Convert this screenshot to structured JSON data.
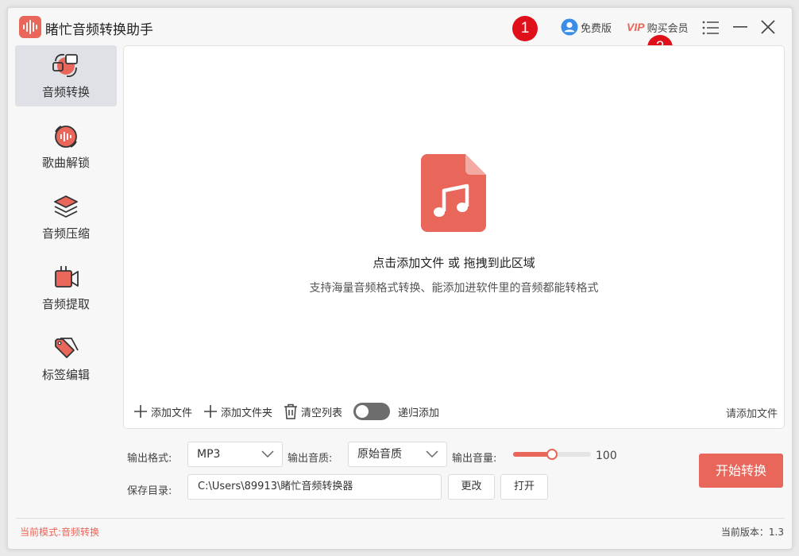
{
  "app": {
    "title": "睹忙音频转换助手"
  },
  "titlebar": {
    "free_label": "免费版",
    "vip_badge": "VIP",
    "buy_label": "购买会员",
    "annotation_1": "1",
    "annotation_2": "2"
  },
  "sidebar": {
    "items": [
      {
        "label": "音频转换",
        "icon": "audio-convert-icon",
        "active": true
      },
      {
        "label": "歌曲解锁",
        "icon": "song-unlock-icon"
      },
      {
        "label": "音频压缩",
        "icon": "audio-compress-icon"
      },
      {
        "label": "音频提取",
        "icon": "audio-extract-icon"
      },
      {
        "label": "标签编辑",
        "icon": "tag-edit-icon"
      }
    ]
  },
  "dropzone": {
    "title": "点击添加文件 或 拖拽到此区域",
    "subtitle": "支持海量音频格式转换、能添加进软件里的音频都能转格式",
    "add_file": "添加文件",
    "add_folder": "添加文件夹",
    "clear_list": "清空列表",
    "recursive_add": "递归添加",
    "recursive_on": false,
    "hint": "请添加文件"
  },
  "settings": {
    "format_label": "输出格式:",
    "format_value": "MP3",
    "quality_label": "输出音质:",
    "quality_value": "原始音质",
    "volume_label": "输出音量:",
    "volume_value": "100",
    "volume_fraction": 0.5,
    "dir_label": "保存目录:",
    "dir_value": "C:\\Users\\89913\\睹忙音频转换器",
    "change_btn": "更改",
    "open_btn": "打开",
    "start_btn": "开始转换"
  },
  "status": {
    "mode": "当前模式:音频转换",
    "version": "当前版本：1.3"
  },
  "colors": {
    "accent": "#e8665a",
    "badge": "#e0101a",
    "free_icon": "#3a8ee6"
  }
}
